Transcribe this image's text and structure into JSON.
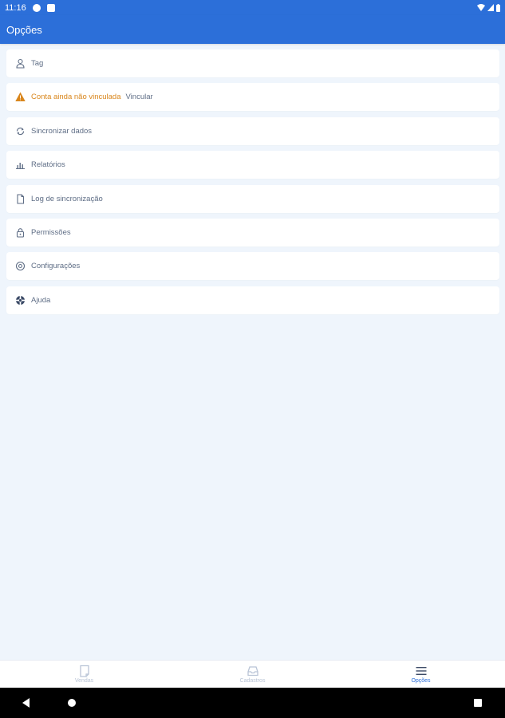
{
  "status_bar": {
    "time": "11:16"
  },
  "app_bar": {
    "title": "Opções"
  },
  "menu": {
    "items": [
      {
        "icon": "person-icon",
        "label": "Tag"
      },
      {
        "icon": "warning-icon",
        "label": "Conta ainda não vinculada",
        "action": "Vincular"
      },
      {
        "icon": "sync-icon",
        "label": "Sincronizar dados"
      },
      {
        "icon": "bar-chart-icon",
        "label": "Relatórios"
      },
      {
        "icon": "document-icon",
        "label": "Log de sincronização"
      },
      {
        "icon": "lock-icon",
        "label": "Permissões"
      },
      {
        "icon": "settings-icon",
        "label": "Configurações"
      },
      {
        "icon": "help-lifebuoy-icon",
        "label": "Ajuda"
      }
    ]
  },
  "bottom_nav": {
    "items": [
      {
        "label": "Vendas",
        "icon": "receipt-icon",
        "active": false
      },
      {
        "label": "Cadastros",
        "icon": "inbox-icon",
        "active": false
      },
      {
        "label": "Opções",
        "icon": "menu-icon",
        "active": true
      }
    ]
  },
  "colors": {
    "primary": "#2c6fd9",
    "background": "#eff5fc",
    "warning": "#d9861c",
    "text": "#5f6e86",
    "inactive": "#b9c4d6"
  }
}
